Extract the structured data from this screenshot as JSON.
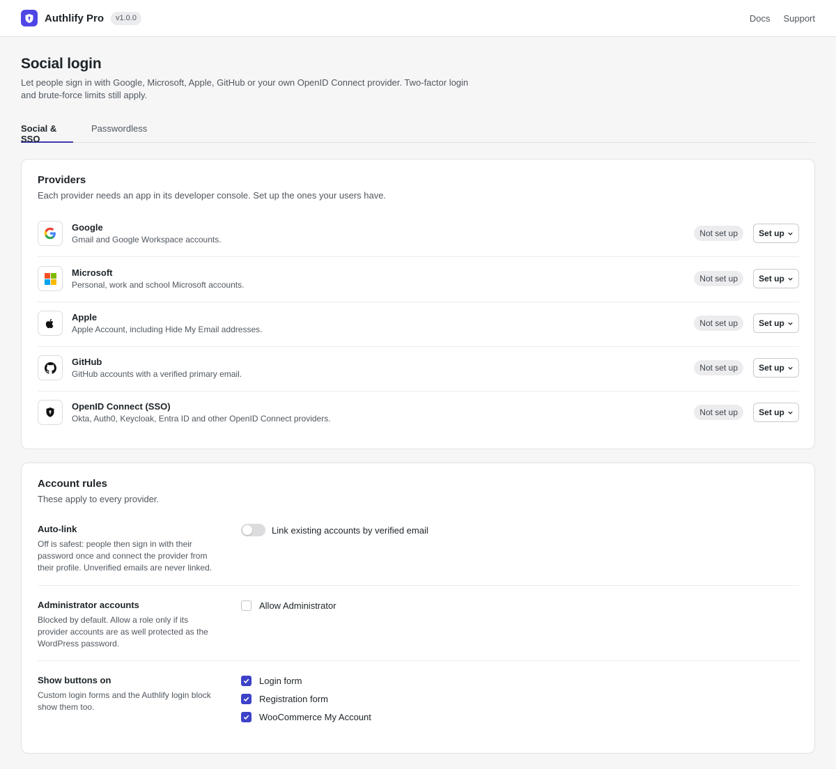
{
  "app": {
    "name": "Authlify Pro",
    "version": "v1.0.0"
  },
  "nav": {
    "docs": "Docs",
    "support": "Support"
  },
  "page": {
    "title": "Social login",
    "description": "Let people sign in with Google, Microsoft, Apple, GitHub or your own OpenID Connect provider. Two-factor login and brute-force limits still apply."
  },
  "tabs": [
    {
      "label": "Social & SSO",
      "active": true
    },
    {
      "label": "Passwordless",
      "active": false
    }
  ],
  "providers_card": {
    "title": "Providers",
    "subtitle": "Each provider needs an app in its developer console. Set up the ones your users have.",
    "items": [
      {
        "name": "Google",
        "description": "Gmail and Google Workspace accounts.",
        "status": "Not set up",
        "action": "Set up",
        "icon": "google-icon"
      },
      {
        "name": "Microsoft",
        "description": "Personal, work and school Microsoft accounts.",
        "status": "Not set up",
        "action": "Set up",
        "icon": "microsoft-icon"
      },
      {
        "name": "Apple",
        "description": "Apple Account, including Hide My Email addresses.",
        "status": "Not set up",
        "action": "Set up",
        "icon": "apple-icon"
      },
      {
        "name": "GitHub",
        "description": "GitHub accounts with a verified primary email.",
        "status": "Not set up",
        "action": "Set up",
        "icon": "github-icon"
      },
      {
        "name": "OpenID Connect (SSO)",
        "description": "Okta, Auth0, Keycloak, Entra ID and other OpenID Connect providers.",
        "status": "Not set up",
        "action": "Set up",
        "icon": "shield-icon"
      }
    ]
  },
  "rules_card": {
    "title": "Account rules",
    "subtitle": "These apply to every provider.",
    "auto_link": {
      "title": "Auto-link",
      "description": "Off is safest: people then sign in with their password once and connect the provider from their profile. Unverified emails are never linked.",
      "toggle_label": "Link existing accounts by verified email",
      "enabled": false
    },
    "admin": {
      "title": "Administrator accounts",
      "description": "Blocked by default. Allow a role only if its provider accounts are as well protected as the WordPress password.",
      "checkbox_label": "Allow Administrator",
      "checked": false
    },
    "show_buttons": {
      "title": "Show buttons on",
      "description": "Custom login forms and the Authlify login block show them too.",
      "options": [
        {
          "label": "Login form",
          "checked": true
        },
        {
          "label": "Registration form",
          "checked": true
        },
        {
          "label": "WooCommerce My Account",
          "checked": true
        }
      ]
    }
  },
  "colors": {
    "accent": "#3d42c8",
    "brand": "#4f46e5"
  }
}
